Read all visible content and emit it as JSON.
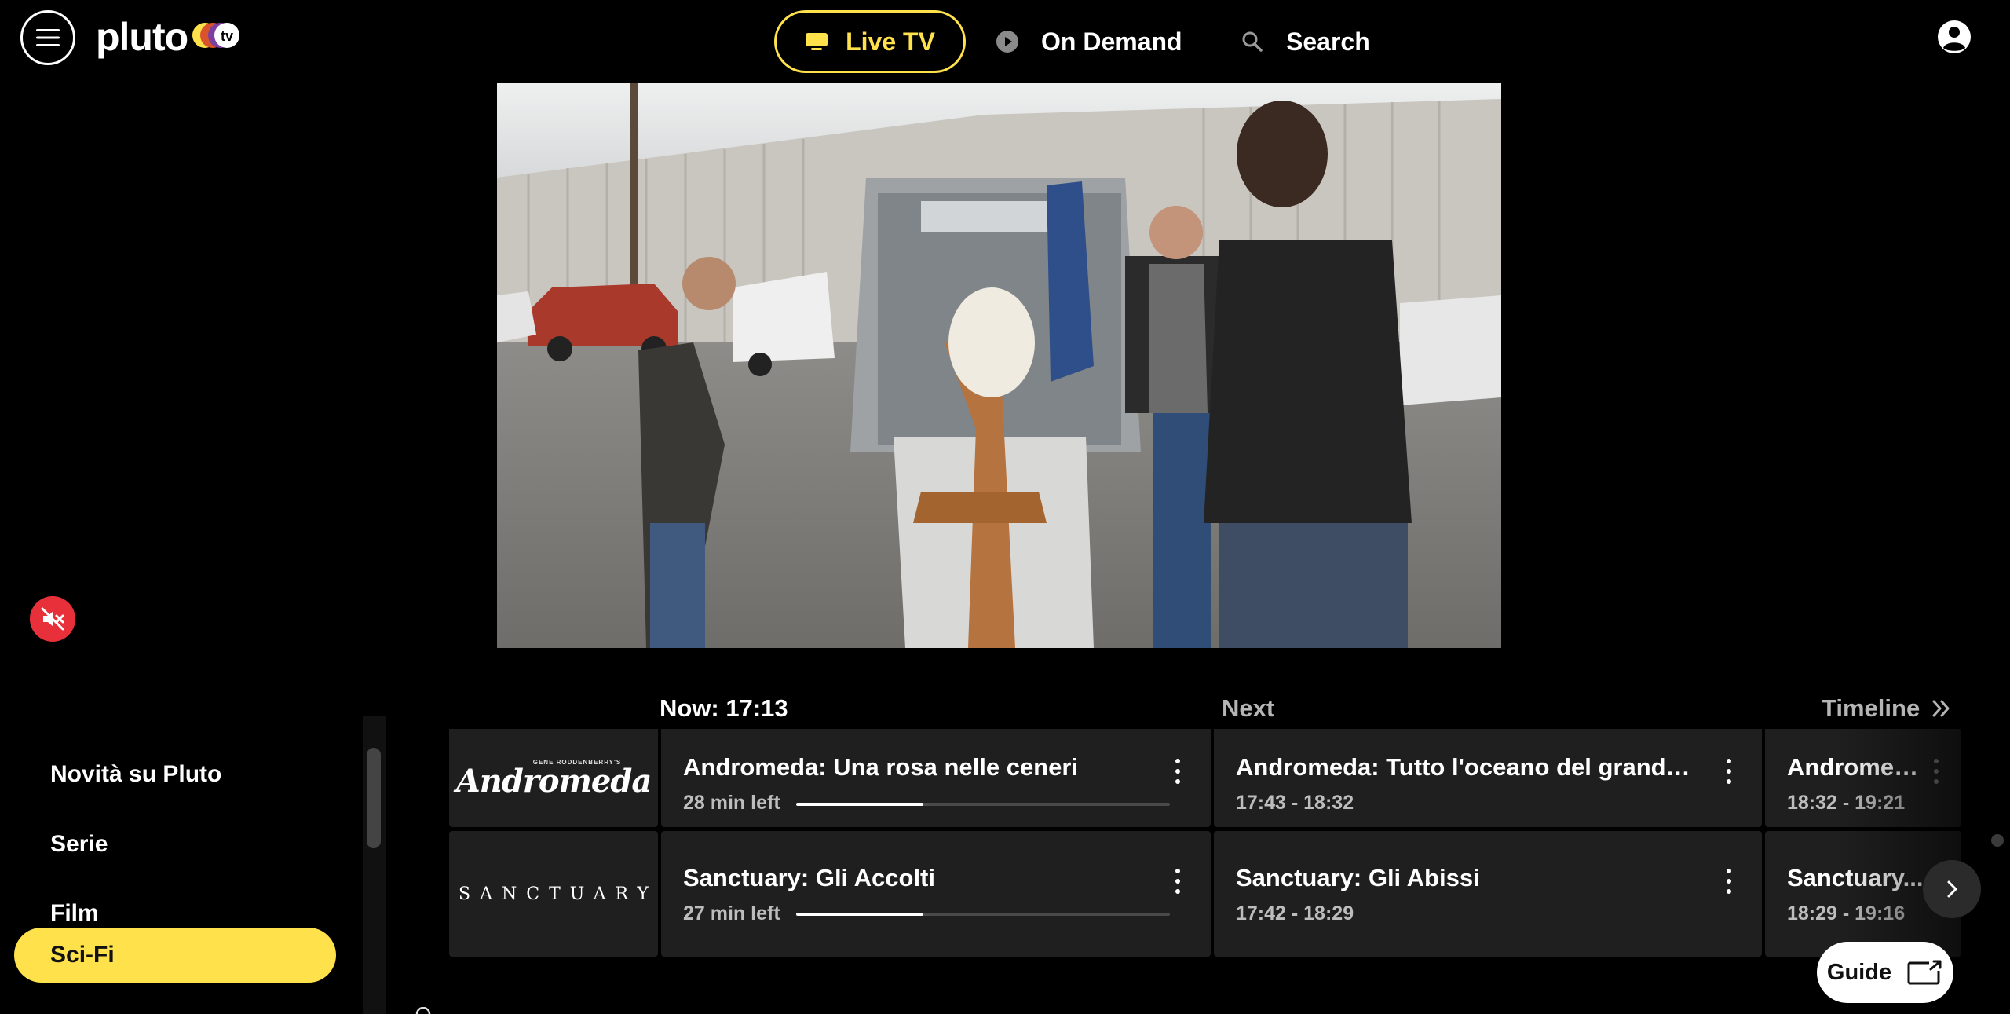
{
  "header": {
    "logo_text": "pluto",
    "logo_badge": "tv",
    "nav": {
      "live_tv": "Live TV",
      "on_demand": "On Demand",
      "search": "Search"
    }
  },
  "categories": [
    {
      "label": "Novità su Pluto",
      "active": false
    },
    {
      "label": "Serie",
      "active": false
    },
    {
      "label": "Film",
      "active": false
    },
    {
      "label": "Sci-Fi",
      "active": true
    }
  ],
  "guide": {
    "now_label": "Now: 17:13",
    "next_label": "Next",
    "timeline_label": "Timeline",
    "rows": [
      {
        "channel": {
          "logo_top": "GENE RODDENBERRY'S",
          "logo_main": "Andromeda"
        },
        "now": {
          "title": "Andromeda: Una rosa nelle ceneri",
          "time_left": "28 min left",
          "progress": 0.34
        },
        "next": {
          "title": "Andromeda: Tutto l'oceano del grande...",
          "time": "17:43 - 18:32"
        },
        "later": {
          "title": "Andromed...",
          "time": "18:32 - 19:21"
        }
      },
      {
        "channel": {
          "logo_main": "SANCTUARY"
        },
        "now": {
          "title": "Sanctuary: Gli Accolti",
          "time_left": "27 min left",
          "progress": 0.34
        },
        "next": {
          "title": "Sanctuary: Gli Abissi",
          "time": "17:42 - 18:29"
        },
        "later": {
          "title": "Sanctuary...",
          "time": "18:29 - 19:16"
        }
      }
    ],
    "guide_button": "Guide"
  },
  "colors": {
    "accent": "#ffe14b",
    "mute": "#e8303a",
    "cell_bg": "#1f1f1f"
  },
  "icons": [
    "menu-icon",
    "tv-icon",
    "play-circle-icon",
    "search-icon",
    "account-icon",
    "mute-icon",
    "double-chevron-right-icon",
    "chevron-right-icon",
    "guide-icon",
    "kebab-icon"
  ]
}
